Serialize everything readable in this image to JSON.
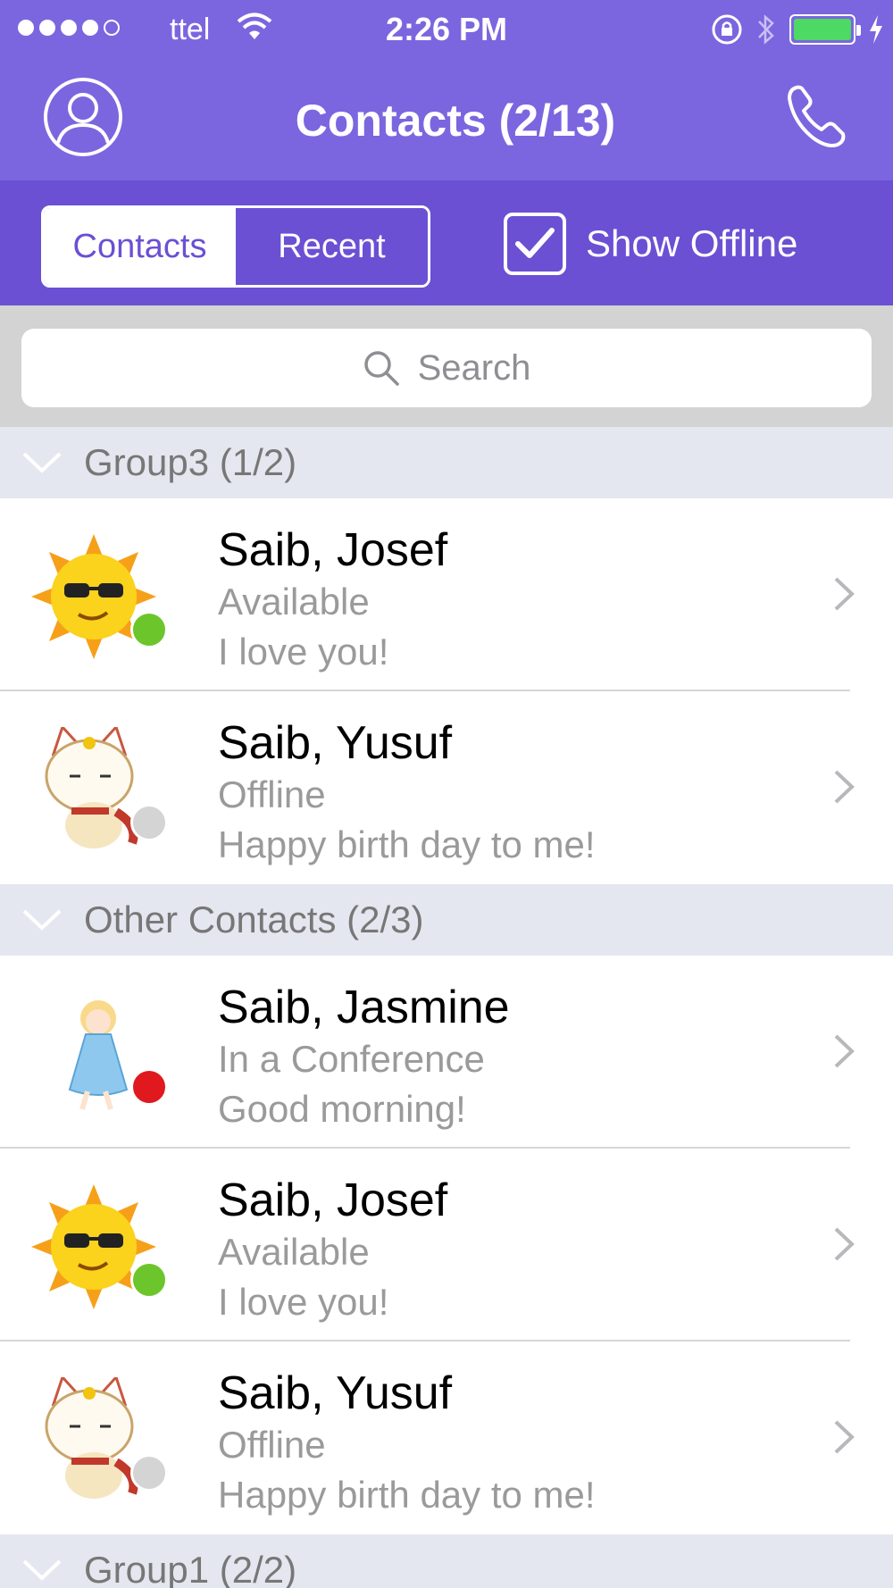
{
  "status_bar": {
    "carrier": "ttel",
    "time": "2:26 PM",
    "signal_bars": 4,
    "signal_max": 5,
    "battery_color": "#4cd964"
  },
  "navbar": {
    "title": "Contacts (2/13)",
    "left_icon": "profile-icon",
    "right_icon": "phone-icon",
    "color": "#7b66e0"
  },
  "segments": {
    "contacts": "Contacts",
    "recent": "Recent",
    "selected": "Contacts"
  },
  "show_offline": {
    "label": "Show Offline",
    "checked": true
  },
  "search": {
    "placeholder": "Search"
  },
  "groups": [
    {
      "title": "Group3 (1/2)",
      "contacts": [
        {
          "name": "Saib, Josef",
          "status": "Available",
          "message": "I love you!",
          "avatar": "sun-avatar",
          "presence_color": "#6cc62b"
        },
        {
          "name": "Saib, Yusuf",
          "status": "Offline",
          "message": "Happy birth day to me!",
          "avatar": "cat-avatar",
          "presence_color": "#d4d4d4"
        }
      ]
    },
    {
      "title": "Other Contacts (2/3)",
      "contacts": [
        {
          "name": "Saib, Jasmine",
          "status": "In a Conference",
          "message": "Good morning!",
          "avatar": "princess-avatar",
          "presence_color": "#e0191e"
        },
        {
          "name": "Saib, Josef",
          "status": "Available",
          "message": "I love you!",
          "avatar": "sun-avatar",
          "presence_color": "#6cc62b"
        },
        {
          "name": "Saib, Yusuf",
          "status": "Offline",
          "message": "Happy birth day to me!",
          "avatar": "cat-avatar",
          "presence_color": "#d4d4d4"
        }
      ]
    },
    {
      "title": "Group1 (2/2)",
      "contacts": []
    }
  ]
}
